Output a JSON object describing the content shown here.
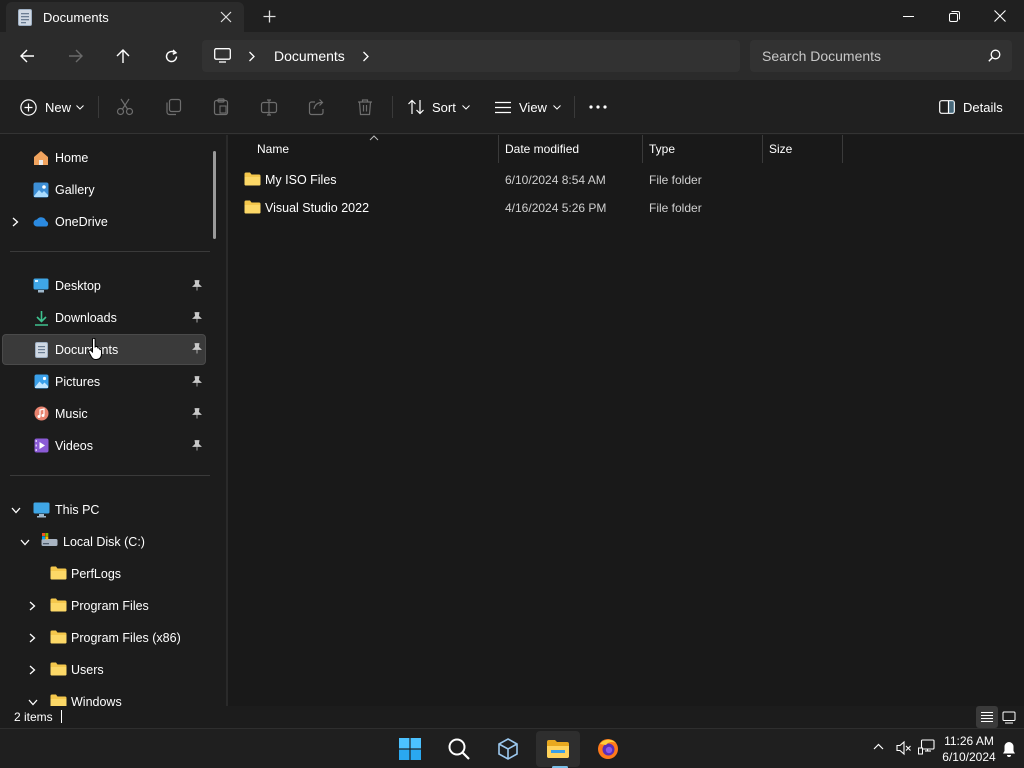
{
  "window": {
    "tab_title": "Documents"
  },
  "address": {
    "crumb": "Documents",
    "search_placeholder": "Search Documents"
  },
  "commands": {
    "new_label": "New",
    "sort_label": "Sort",
    "view_label": "View",
    "details_label": "Details"
  },
  "nav": {
    "quick": [
      {
        "label": "Home",
        "icon": "home-icon"
      },
      {
        "label": "Gallery",
        "icon": "gallery-icon"
      },
      {
        "label": "OneDrive",
        "icon": "onedrive-icon"
      }
    ],
    "pinned": [
      {
        "label": "Desktop",
        "icon": "desktop-icon"
      },
      {
        "label": "Downloads",
        "icon": "downloads-icon"
      },
      {
        "label": "Documents",
        "icon": "documents-icon"
      },
      {
        "label": "Pictures",
        "icon": "pictures-icon"
      },
      {
        "label": "Music",
        "icon": "music-icon"
      },
      {
        "label": "Videos",
        "icon": "videos-icon"
      }
    ],
    "tree": [
      {
        "label": "This PC",
        "icon": "pc-icon"
      },
      {
        "label": "Local Disk (C:)",
        "icon": "drive-icon"
      },
      {
        "label": "PerfLogs",
        "icon": "folder-icon"
      },
      {
        "label": "Program Files",
        "icon": "folder-icon"
      },
      {
        "label": "Program Files (x86)",
        "icon": "folder-icon"
      },
      {
        "label": "Users",
        "icon": "folder-icon"
      },
      {
        "label": "Windows",
        "icon": "folder-icon"
      }
    ]
  },
  "columns": {
    "name": "Name",
    "date": "Date modified",
    "type": "Type",
    "size": "Size"
  },
  "files": [
    {
      "name": "My ISO Files",
      "date": "6/10/2024 8:54 AM",
      "type": "File folder"
    },
    {
      "name": "Visual Studio 2022",
      "date": "4/16/2024 5:26 PM",
      "type": "File folder"
    }
  ],
  "status": {
    "count": "2 items"
  },
  "clock": {
    "time": "11:26 AM",
    "date": "6/10/2024"
  },
  "colors": {
    "accent": "#7ac0e8",
    "folder": "#f4c74c",
    "background": "#1c1c1c"
  }
}
